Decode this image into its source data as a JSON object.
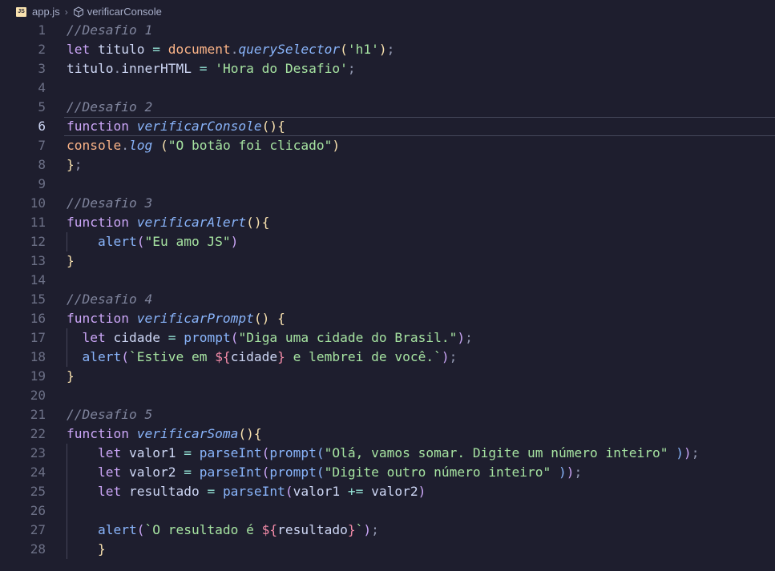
{
  "breadcrumb": {
    "file": "app.js",
    "symbol": "verificarConsole",
    "file_icon": "js-file-icon",
    "symbol_icon": "cube-icon"
  },
  "editor": {
    "current_line": 6,
    "lines": [
      {
        "n": "1",
        "tokens": [
          {
            "t": "//Desafio 1",
            "c": "comment"
          }
        ]
      },
      {
        "n": "2",
        "tokens": [
          {
            "t": "let",
            "c": "kw"
          },
          {
            "t": " titulo ",
            "c": "var"
          },
          {
            "t": "=",
            "c": "op"
          },
          {
            "t": " ",
            "c": "var"
          },
          {
            "t": "document",
            "c": "obj"
          },
          {
            "t": ".",
            "c": "punc"
          },
          {
            "t": "querySelector",
            "c": "fnit"
          },
          {
            "t": "(",
            "c": "br1"
          },
          {
            "t": "'h1'",
            "c": "str"
          },
          {
            "t": ")",
            "c": "br1"
          },
          {
            "t": ";",
            "c": "punc"
          }
        ]
      },
      {
        "n": "3",
        "tokens": [
          {
            "t": "titulo",
            "c": "var"
          },
          {
            "t": ".",
            "c": "punc"
          },
          {
            "t": "innerHTML ",
            "c": "var"
          },
          {
            "t": "=",
            "c": "op"
          },
          {
            "t": " ",
            "c": "var"
          },
          {
            "t": "'Hora do Desafio'",
            "c": "str"
          },
          {
            "t": ";",
            "c": "punc"
          }
        ]
      },
      {
        "n": "4",
        "tokens": []
      },
      {
        "n": "5",
        "tokens": [
          {
            "t": "//Desafio 2",
            "c": "comment"
          }
        ]
      },
      {
        "n": "6",
        "tokens": [
          {
            "t": "function",
            "c": "kw"
          },
          {
            "t": " ",
            "c": "var"
          },
          {
            "t": "verificarConsole",
            "c": "fnit"
          },
          {
            "t": "(){",
            "c": "br1"
          }
        ]
      },
      {
        "n": "7",
        "tokens": [
          {
            "t": "console",
            "c": "obj"
          },
          {
            "t": ".",
            "c": "punc"
          },
          {
            "t": "log",
            "c": "fnit"
          },
          {
            "t": " ",
            "c": "var"
          },
          {
            "t": "(",
            "c": "br1"
          },
          {
            "t": "\"O botão foi clicado\"",
            "c": "str"
          },
          {
            "t": ")",
            "c": "br1"
          }
        ]
      },
      {
        "n": "8",
        "tokens": [
          {
            "t": "}",
            "c": "br1"
          },
          {
            "t": ";",
            "c": "punc"
          }
        ]
      },
      {
        "n": "9",
        "tokens": []
      },
      {
        "n": "10",
        "tokens": [
          {
            "t": "//Desafio 3",
            "c": "comment"
          }
        ]
      },
      {
        "n": "11",
        "tokens": [
          {
            "t": "function",
            "c": "kw"
          },
          {
            "t": " ",
            "c": "var"
          },
          {
            "t": "verificarAlert",
            "c": "fnit"
          },
          {
            "t": "(){",
            "c": "br1"
          }
        ]
      },
      {
        "n": "12",
        "tokens": [
          {
            "t": "    ",
            "c": "var"
          },
          {
            "t": "alert",
            "c": "fn"
          },
          {
            "t": "(",
            "c": "br2"
          },
          {
            "t": "\"Eu amo JS\"",
            "c": "str"
          },
          {
            "t": ")",
            "c": "br2"
          }
        ]
      },
      {
        "n": "13",
        "tokens": [
          {
            "t": "}",
            "c": "br1"
          }
        ]
      },
      {
        "n": "14",
        "tokens": []
      },
      {
        "n": "15",
        "tokens": [
          {
            "t": "//Desafio 4",
            "c": "comment"
          }
        ]
      },
      {
        "n": "16",
        "tokens": [
          {
            "t": "function",
            "c": "kw"
          },
          {
            "t": " ",
            "c": "var"
          },
          {
            "t": "verificarPrompt",
            "c": "fnit"
          },
          {
            "t": "()",
            "c": "br1"
          },
          {
            "t": " ",
            "c": "var"
          },
          {
            "t": "{",
            "c": "br1"
          }
        ]
      },
      {
        "n": "17",
        "tokens": [
          {
            "t": "  ",
            "c": "var"
          },
          {
            "t": "let",
            "c": "kw"
          },
          {
            "t": " cidade ",
            "c": "var"
          },
          {
            "t": "=",
            "c": "op"
          },
          {
            "t": " ",
            "c": "var"
          },
          {
            "t": "prompt",
            "c": "fn"
          },
          {
            "t": "(",
            "c": "br2"
          },
          {
            "t": "\"Diga uma cidade do Brasil.\"",
            "c": "str"
          },
          {
            "t": ")",
            "c": "br2"
          },
          {
            "t": ";",
            "c": "punc"
          }
        ]
      },
      {
        "n": "18",
        "tokens": [
          {
            "t": "  ",
            "c": "var"
          },
          {
            "t": "alert",
            "c": "fn"
          },
          {
            "t": "(",
            "c": "br2"
          },
          {
            "t": "`Estive em ",
            "c": "str"
          },
          {
            "t": "${",
            "c": "interp"
          },
          {
            "t": "cidade",
            "c": "var"
          },
          {
            "t": "}",
            "c": "interp"
          },
          {
            "t": " e lembrei de você.`",
            "c": "str"
          },
          {
            "t": ")",
            "c": "br2"
          },
          {
            "t": ";",
            "c": "punc"
          }
        ]
      },
      {
        "n": "19",
        "tokens": [
          {
            "t": "}",
            "c": "br1"
          }
        ]
      },
      {
        "n": "20",
        "tokens": []
      },
      {
        "n": "21",
        "tokens": [
          {
            "t": "//Desafio 5",
            "c": "comment"
          }
        ]
      },
      {
        "n": "22",
        "tokens": [
          {
            "t": "function",
            "c": "kw"
          },
          {
            "t": " ",
            "c": "var"
          },
          {
            "t": "verificarSoma",
            "c": "fnit"
          },
          {
            "t": "(){",
            "c": "br1"
          }
        ]
      },
      {
        "n": "23",
        "tokens": [
          {
            "t": "    ",
            "c": "var"
          },
          {
            "t": "let",
            "c": "kw"
          },
          {
            "t": " valor1 ",
            "c": "var"
          },
          {
            "t": "=",
            "c": "op"
          },
          {
            "t": " ",
            "c": "var"
          },
          {
            "t": "parseInt",
            "c": "fn"
          },
          {
            "t": "(",
            "c": "br2"
          },
          {
            "t": "prompt",
            "c": "fn"
          },
          {
            "t": "(",
            "c": "br3"
          },
          {
            "t": "\"Olá, vamos somar. Digite um número inteiro\"",
            "c": "str"
          },
          {
            "t": " ",
            "c": "var"
          },
          {
            "t": ")",
            "c": "br3"
          },
          {
            "t": ")",
            "c": "br2"
          },
          {
            "t": ";",
            "c": "punc"
          }
        ]
      },
      {
        "n": "24",
        "tokens": [
          {
            "t": "    ",
            "c": "var"
          },
          {
            "t": "let",
            "c": "kw"
          },
          {
            "t": " valor2 ",
            "c": "var"
          },
          {
            "t": "=",
            "c": "op"
          },
          {
            "t": " ",
            "c": "var"
          },
          {
            "t": "parseInt",
            "c": "fn"
          },
          {
            "t": "(",
            "c": "br2"
          },
          {
            "t": "prompt",
            "c": "fn"
          },
          {
            "t": "(",
            "c": "br3"
          },
          {
            "t": "\"Digite outro número inteiro\"",
            "c": "str"
          },
          {
            "t": " ",
            "c": "var"
          },
          {
            "t": ")",
            "c": "br3"
          },
          {
            "t": ")",
            "c": "br2"
          },
          {
            "t": ";",
            "c": "punc"
          }
        ]
      },
      {
        "n": "25",
        "tokens": [
          {
            "t": "    ",
            "c": "var"
          },
          {
            "t": "let",
            "c": "kw"
          },
          {
            "t": " resultado ",
            "c": "var"
          },
          {
            "t": "=",
            "c": "op"
          },
          {
            "t": " ",
            "c": "var"
          },
          {
            "t": "parseInt",
            "c": "fn"
          },
          {
            "t": "(",
            "c": "br2"
          },
          {
            "t": "valor1 ",
            "c": "var"
          },
          {
            "t": "+=",
            "c": "op"
          },
          {
            "t": " valor2",
            "c": "var"
          },
          {
            "t": ")",
            "c": "br2"
          }
        ]
      },
      {
        "n": "26",
        "tokens": []
      },
      {
        "n": "27",
        "tokens": [
          {
            "t": "    ",
            "c": "var"
          },
          {
            "t": "alert",
            "c": "fn"
          },
          {
            "t": "(",
            "c": "br2"
          },
          {
            "t": "`O resultado é ",
            "c": "str"
          },
          {
            "t": "${",
            "c": "interp"
          },
          {
            "t": "resultado",
            "c": "var"
          },
          {
            "t": "}",
            "c": "interp"
          },
          {
            "t": "`",
            "c": "str"
          },
          {
            "t": ")",
            "c": "br2"
          },
          {
            "t": ";",
            "c": "punc"
          }
        ]
      },
      {
        "n": "28",
        "tokens": [
          {
            "t": "    ",
            "c": "var"
          },
          {
            "t": "}",
            "c": "br1"
          }
        ]
      }
    ]
  }
}
